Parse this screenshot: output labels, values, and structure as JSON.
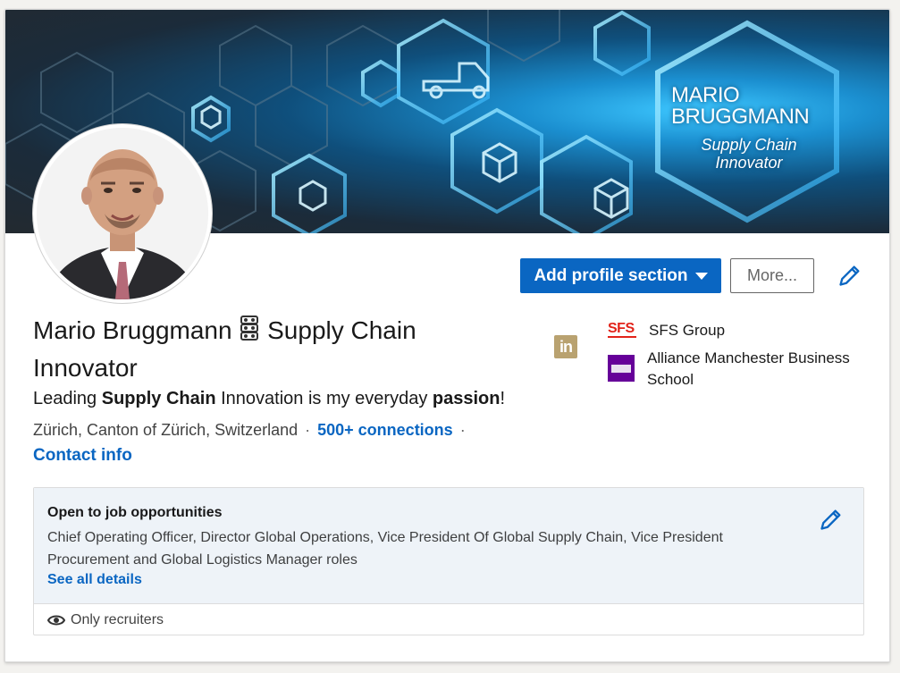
{
  "banner": {
    "title": "MARIO BRUGGMANN",
    "subtitle": "Supply Chain Innovator"
  },
  "profile": {
    "name": "Mario Bruggmann",
    "name_suffix": "Supply Chain Innovator",
    "headline_parts": [
      "Leading ",
      "Supply Chain",
      " Innovation is my everyday ",
      "passion",
      "!"
    ],
    "location": "Zürich, Canton of Zürich, Switzerland",
    "separator": "·",
    "connections": "500+ connections",
    "contact_info": "Contact info"
  },
  "actions": {
    "add_section": "Add profile section",
    "more": "More..."
  },
  "badges": {
    "linkedin": "in"
  },
  "organizations": [
    {
      "label": "SFS Group",
      "logo_text": "SFS"
    },
    {
      "label": "Alliance Manchester Business School"
    }
  ],
  "open_to_work": {
    "title": "Open to job opportunities",
    "description": "Chief Operating Officer, Director Global Operations, Vice President Of Global Supply Chain, Vice President Procurement and Global Logistics Manager roles",
    "link": "See all details",
    "visibility": "Only recruiters"
  },
  "colors": {
    "primary": "#0a66c2",
    "sfs_red": "#e2231a",
    "amb_purple": "#660099",
    "linkedin_gold": "#b9a270",
    "jobs_bg": "#eef3f8"
  },
  "icons": [
    "pencil-icon",
    "eye-icon",
    "caret-down-icon",
    "chain-icon",
    "linkedin-icon"
  ]
}
